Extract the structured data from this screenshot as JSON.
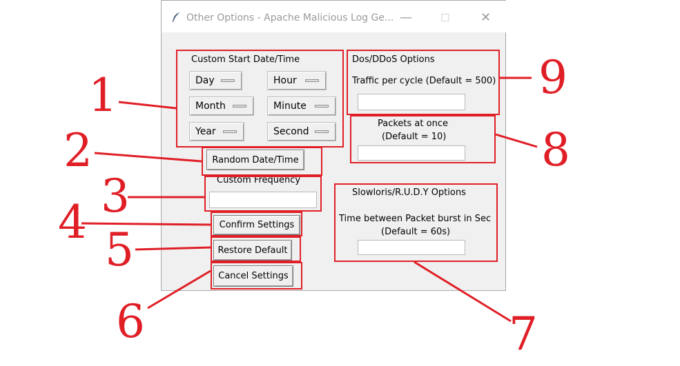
{
  "window": {
    "title": "Other Options - Apache Malicious Log Ge...",
    "min_glyph": "—",
    "max_glyph": "☐",
    "close_glyph": "✕"
  },
  "start_datetime": {
    "label": "Custom Start Date/Time",
    "day": "Day",
    "hour": "Hour",
    "month": "Month",
    "minute": "Minute",
    "year": "Year",
    "second": "Second",
    "random_button": "Random Date/Time"
  },
  "frequency": {
    "label": "Custom Frequency",
    "value": ""
  },
  "actions": {
    "confirm": "Confirm Settings",
    "restore": "Restore Default",
    "cancel": "Cancel Settings"
  },
  "dos": {
    "label": "Dos/DDoS Options",
    "traffic_label": "Traffic per cycle (Default = 500)",
    "traffic_value": "",
    "packets_label_1": "Packets at once",
    "packets_label_2": "(Default = 10)",
    "packets_value": ""
  },
  "slowloris": {
    "label": "Slowloris/R.U.D.Y Options",
    "time_label_1": "Time between Packet burst in Sec",
    "time_label_2": "(Default = 60s)",
    "time_value": ""
  },
  "annotations": [
    "1",
    "2",
    "3",
    "4",
    "5",
    "6",
    "7",
    "8",
    "9"
  ],
  "colors": {
    "annotation": "#e01e26",
    "window_bg": "#f0f0f0"
  }
}
